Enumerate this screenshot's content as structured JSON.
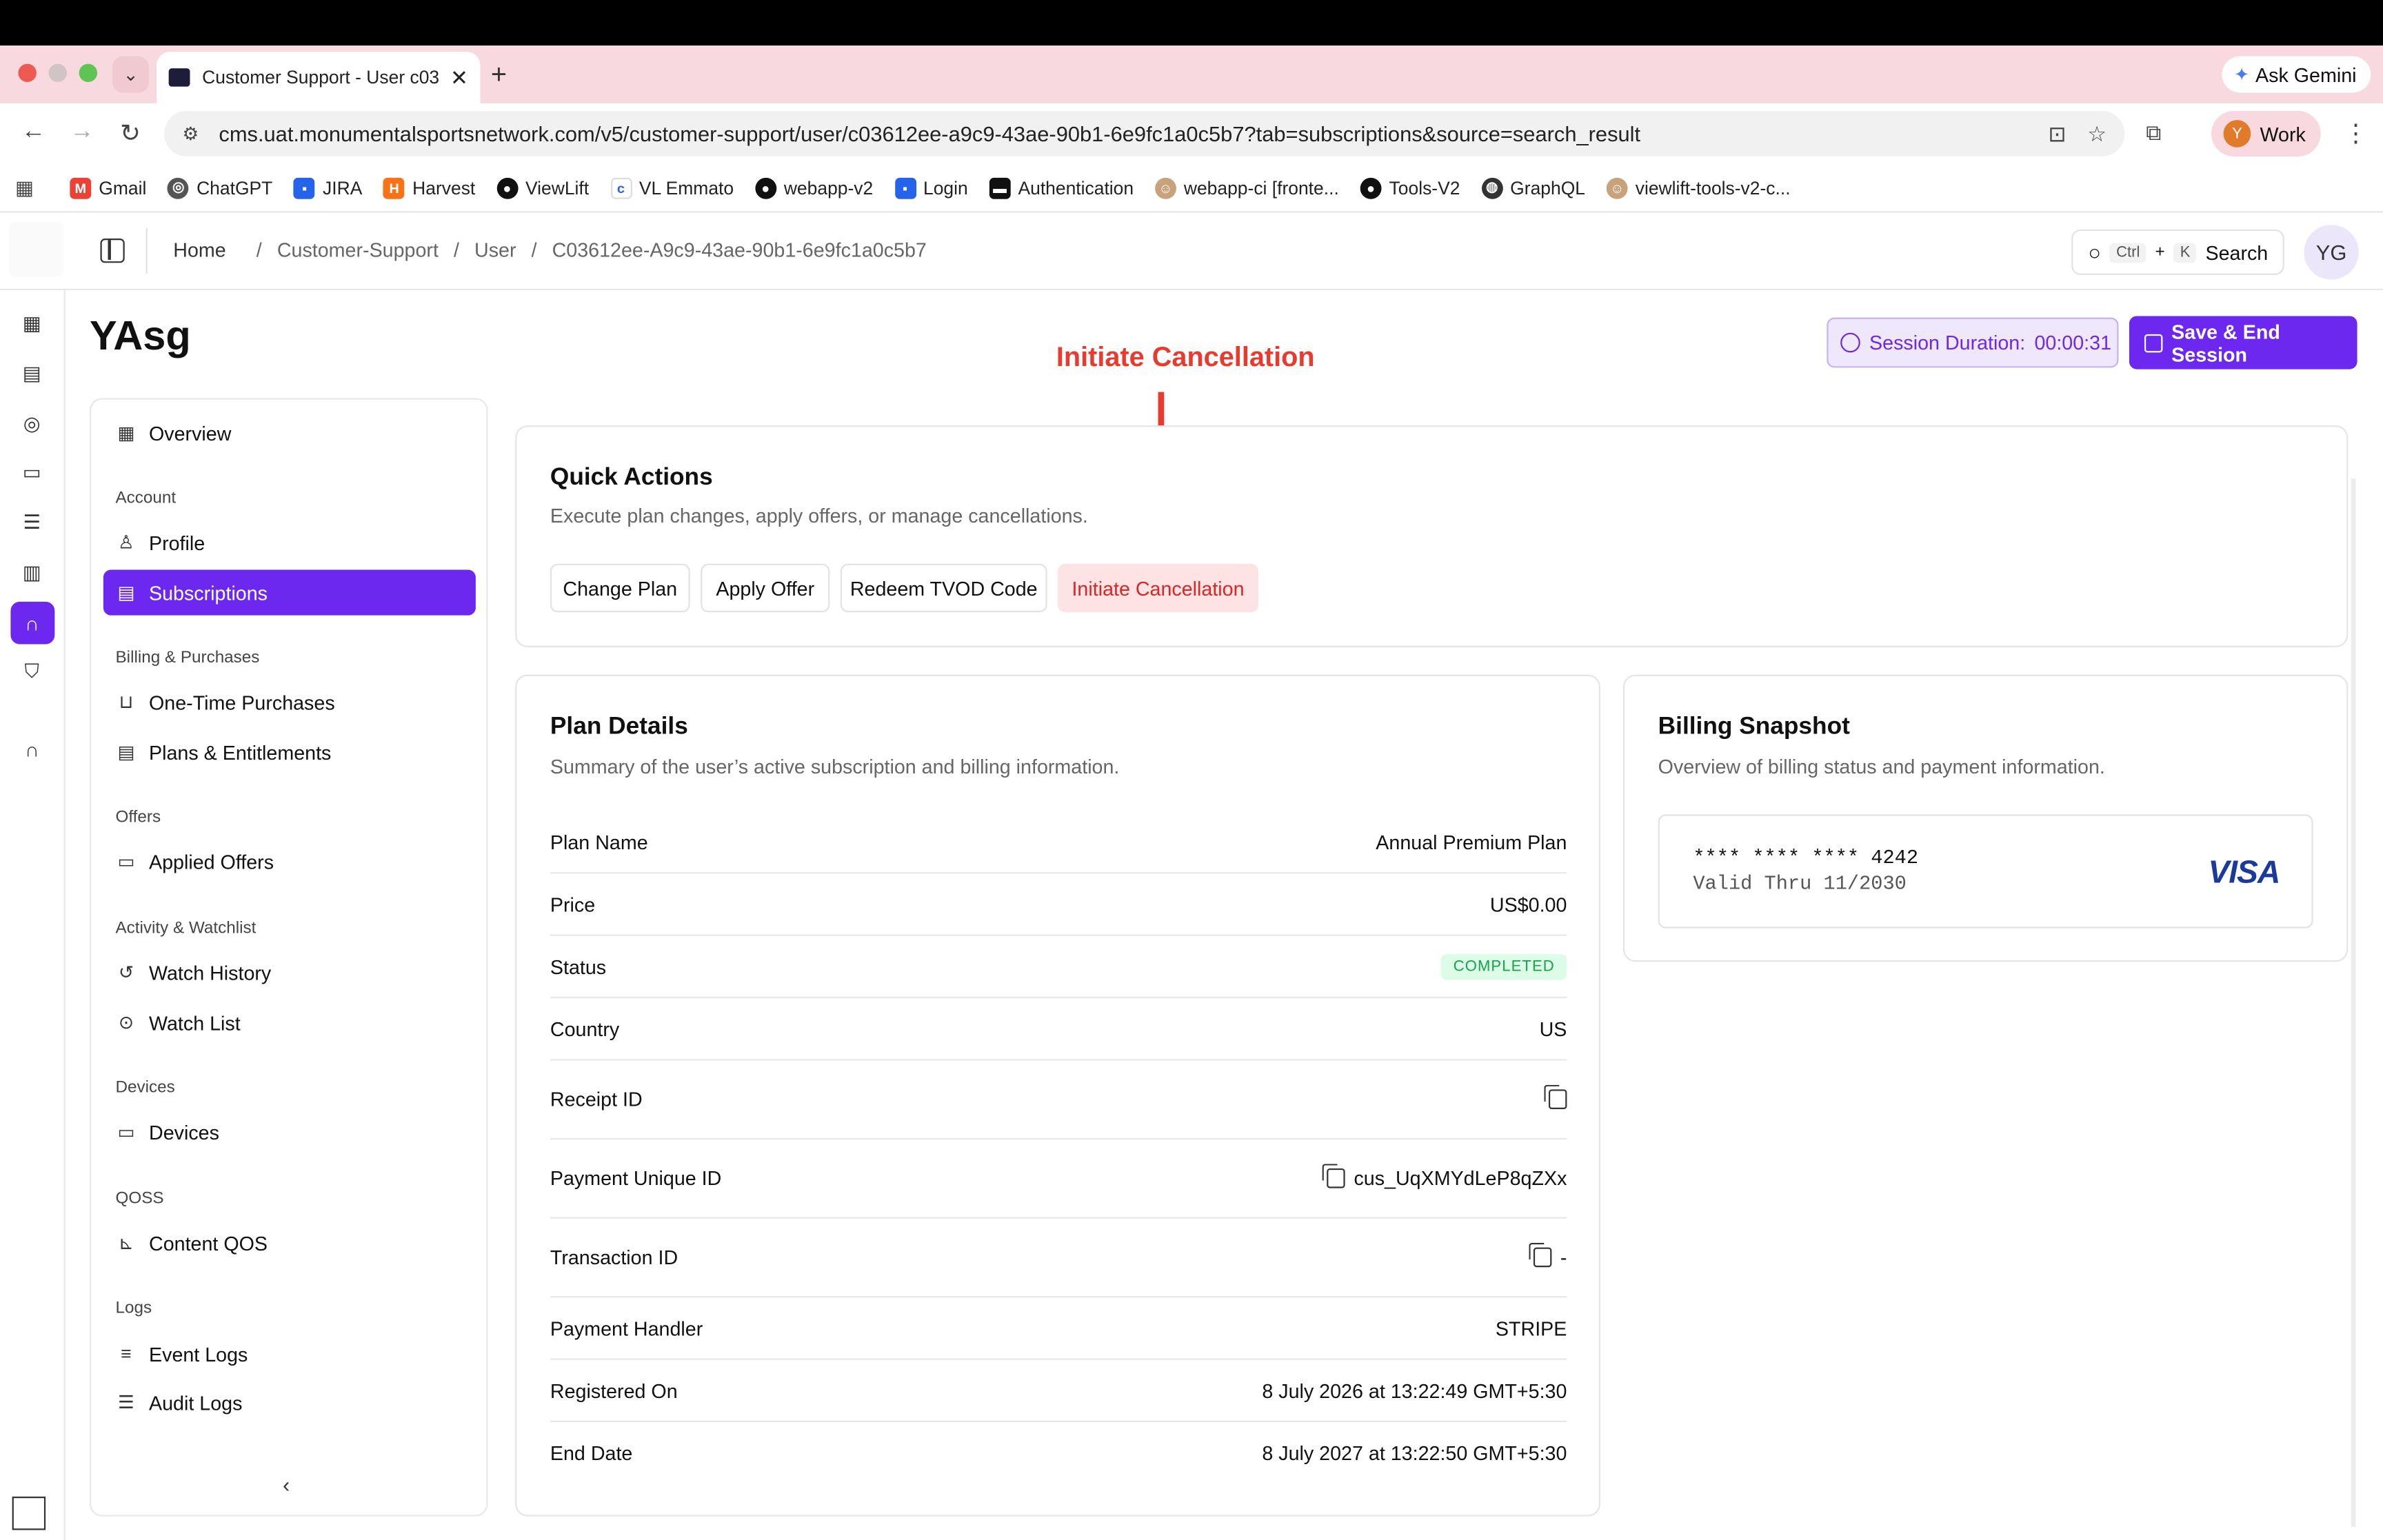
{
  "browser": {
    "tab_title": "Customer Support - User c03",
    "url": "cms.uat.monumentalsportsnetwork.com/v5/customer-support/user/c03612ee-a9c9-43ae-90b1-6e9fc1a0c5b7?tab=subscriptions&source=search_result",
    "ask_gemini": "Ask Gemini",
    "profile_initial": "Y",
    "profile_label": "Work",
    "bookmarks": [
      "Gmail",
      "ChatGPT",
      "JIRA",
      "Harvest",
      "ViewLift",
      "VL Emmato",
      "webapp-v2",
      "Login",
      "Authentication",
      "webapp-ci [fronte...",
      "Tools-V2",
      "GraphQL",
      "viewlift-tools-v2-c..."
    ]
  },
  "header": {
    "breadcrumb": [
      "Home",
      "/",
      "Customer-Support",
      "/",
      "User",
      "/",
      "C03612ee-A9c9-43ae-90b1-6e9fc1a0c5b7"
    ],
    "search_kbd_1": "Ctrl",
    "search_plus": "+",
    "search_kbd_2": "K",
    "search_label": "Search",
    "avatar": "YG"
  },
  "page": {
    "title": "YAsg",
    "session_label": "Session Duration:",
    "session_value": "00:00:31",
    "save_label": "Save & End Session",
    "annotation": "Initiate Cancellation"
  },
  "sidebar": {
    "overview": "Overview",
    "sections": [
      {
        "title": "Account",
        "items": [
          "Profile",
          "Subscriptions"
        ]
      },
      {
        "title": "Billing & Purchases",
        "items": [
          "One-Time Purchases",
          "Plans & Entitlements"
        ]
      },
      {
        "title": "Offers",
        "items": [
          "Applied Offers"
        ]
      },
      {
        "title": "Activity & Watchlist",
        "items": [
          "Watch History",
          "Watch List"
        ]
      },
      {
        "title": "Devices",
        "items": [
          "Devices"
        ]
      },
      {
        "title": "QOSS",
        "items": [
          "Content QOS"
        ]
      },
      {
        "title": "Logs",
        "items": [
          "Event Logs",
          "Audit Logs"
        ]
      }
    ],
    "active": "Subscriptions"
  },
  "quick_actions": {
    "title": "Quick Actions",
    "subtitle": "Execute plan changes, apply offers, or manage cancellations.",
    "buttons": [
      "Change Plan",
      "Apply Offer",
      "Redeem TVOD Code",
      "Initiate Cancellation"
    ]
  },
  "plan_details": {
    "title": "Plan Details",
    "subtitle": "Summary of the user’s active subscription and billing information.",
    "rows": [
      {
        "label": "Plan Name",
        "value": "Annual Premium Plan"
      },
      {
        "label": "Price",
        "value": "US$0.00"
      },
      {
        "label": "Status",
        "value": "COMPLETED"
      },
      {
        "label": "Country",
        "value": "US"
      },
      {
        "label": "Receipt ID",
        "value": ""
      },
      {
        "label": "Payment Unique ID",
        "value": "cus_UqXMYdLeP8qZXx"
      },
      {
        "label": "Transaction ID",
        "value": "-"
      },
      {
        "label": "Payment Handler",
        "value": "STRIPE"
      },
      {
        "label": "Registered On",
        "value": "8 July 2026 at 13:22:49 GMT+5:30"
      },
      {
        "label": "End Date",
        "value": "8 July 2027 at 13:22:50 GMT+5:30"
      }
    ]
  },
  "billing": {
    "title": "Billing Snapshot",
    "subtitle": "Overview of billing status and payment information.",
    "card_number": "**** **** **** 4242",
    "valid_thru": "Valid Thru 11/2030",
    "brand": "VISA"
  },
  "colors": {
    "accent": "#6d28f0",
    "danger": "#dc2626",
    "annotation": "#e83b2e",
    "success": "#16a34a"
  }
}
